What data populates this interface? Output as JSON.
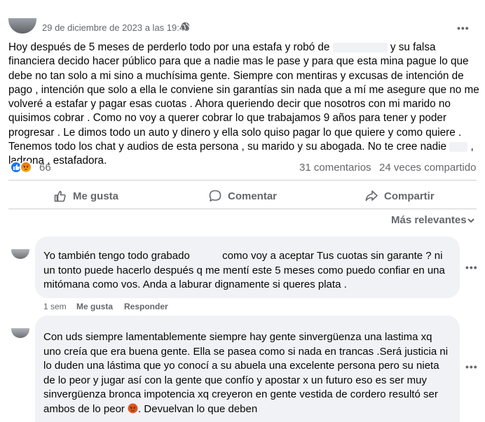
{
  "post": {
    "date": "29 de diciembre de 2023 a las 19:45",
    "body_before_redact1": "Hoy después de 5 meses de perderlo todo por una estafa y robó de ",
    "body_after_redact1": " y su falsa financiera decido hacer público para que a nadie mas le pase y para  que esta mina pague lo que debe no tan solo a mi sino a muchísima gente. Siempre con mentiras y excusas de intención de pago , intención que solo a ella le conviene sin garantías sin nada que a mí me asegure que no me volveré a estafar y pagar esas cuotas . Ahora queriendo decir que nosotros con mi marido no quisimos cobrar . Como no voy a querer cobrar lo que trabajamos 9 años para tener y poder progresar . Le dimos todo un auto y dinero y ella solo quiso pagar lo que quiere y como quiere . Tenemos todo los chat y audios de esta persona , su marido y su abogada. No te cree nadie ",
    "body_after_redact2": " , ladrona , estafadora.",
    "reaction_count": "66",
    "comments_count": "31 comentarios",
    "shares_count": "24 veces compartido"
  },
  "actions": {
    "like": "Me gusta",
    "comment": "Comentar",
    "share": "Compartir"
  },
  "sort": {
    "label": "Más relevantes"
  },
  "comments": [
    {
      "text_before": "Yo también tengo todo grabado ",
      "text_after": " como voy a aceptar Tus cuotas sin garante ? ni un tonto puede hacerlo después q me mentí este 5 meses como puedo confiar en una mitómana como vos. Anda a laburar dignamente si queres plata .",
      "time": "1 sem",
      "like": "Me gusta",
      "reply": "Responder"
    },
    {
      "text": "Con uds siempre lamentablemente siempre hay gente sinvergüenza una lastima xq uno creía que era buena gente. Ella se pasea como si nada en trancas .Será justicia ni lo duden una lástima que yo conocí a su abuela una excelente persona pero su nieta de lo peor y jugar así con la gente que confío y apostar x un futuro eso es ser muy sinvergüenza bronca impotencia xq creyeron en gente vestida de cordero resultó ser ambos de lo peor ",
      "text_end": ". Devuelvan lo que deben"
    }
  ],
  "icons": {
    "globe": "globe-icon",
    "more": "more-options-icon",
    "like": "thumbs-up-icon",
    "comment": "speech-bubble-icon",
    "share": "share-arrow-icon",
    "chevron": "chevron-down-icon",
    "angry": "angry-face-emoji"
  },
  "colors": {
    "accent": "#1877f2",
    "muted": "#65676b",
    "bubble": "#f0f2f5"
  }
}
